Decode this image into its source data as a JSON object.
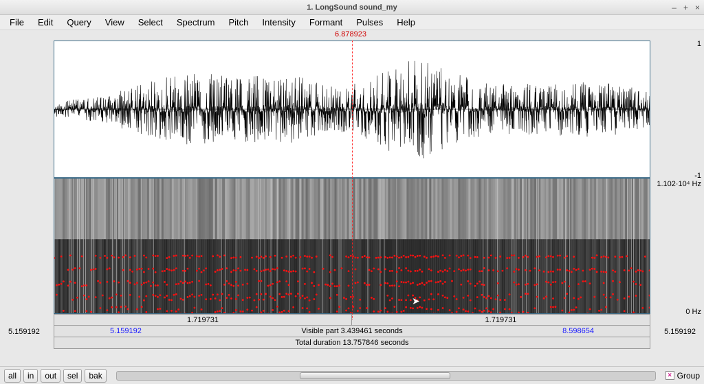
{
  "window": {
    "title": "1. LongSound sound_my"
  },
  "menubar": {
    "file": "File",
    "edit": "Edit",
    "query": "Query",
    "view": "View",
    "select": "Select",
    "spectrum": "Spectrum",
    "pitch": "Pitch",
    "intensity": "Intensity",
    "formant": "Formant",
    "pulses": "Pulses",
    "help": "Help"
  },
  "cursor": {
    "time_label": "6.878923"
  },
  "waveform": {
    "y_max": "1",
    "y_min": "-1"
  },
  "spectrogram": {
    "f_max": "1.102·10⁴ Hz",
    "f_min": "0 Hz"
  },
  "splitbar": {
    "left_segment": "1.719731",
    "right_segment": "1.719731"
  },
  "visible_bar": {
    "edge_left_out": "5.159192",
    "edge_left_in": "5.159192",
    "center": "Visible part 3.439461 seconds",
    "edge_right_in": "8.598654",
    "edge_right_out": "5.159192"
  },
  "total_bar": {
    "label": "Total duration 13.757846 seconds"
  },
  "buttons": {
    "all": "all",
    "in": "in",
    "out": "out",
    "sel": "sel",
    "bak": "bak"
  },
  "group": {
    "label": "Group",
    "checked": true
  },
  "scrollbar": {
    "thumb_left_pct": 34,
    "thumb_width_pct": 28
  },
  "chart_data": {
    "type": "other",
    "title": "Sound editor — waveform + spectrogram",
    "cursor_time_s": 6.878923,
    "visible_window_s": [
      5.159192,
      8.598654
    ],
    "visible_part_s": 3.439461,
    "split_segments_s": [
      1.719731,
      1.719731
    ],
    "total_duration_s": 13.757846,
    "waveform_ylim": [
      -1,
      1
    ],
    "spectrogram_hz_range": [
      0,
      11020
    ]
  }
}
